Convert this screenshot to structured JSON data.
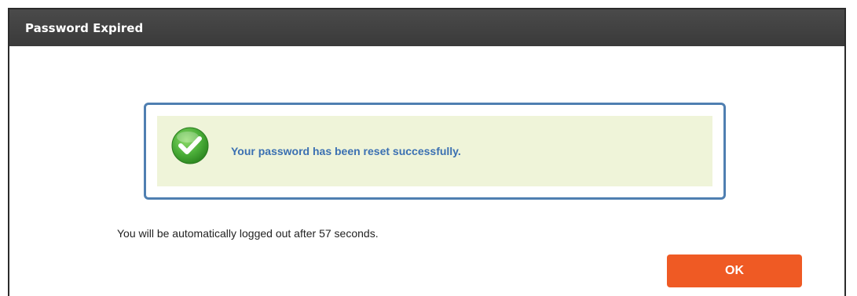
{
  "dialog": {
    "title": "Password Expired"
  },
  "message": {
    "icon": "checkmark-circle-icon",
    "text": "Your password has been reset successfully."
  },
  "logout_note": "You will be automatically logged out after 57 seconds.",
  "buttons": {
    "ok_label": "OK"
  },
  "colors": {
    "titlebar": "#3f3f3f",
    "message_border": "#4f7fb1",
    "message_background": "#eff4d9",
    "message_text": "#3b70b2",
    "ok_button": "#ef5a24",
    "success_icon": "#4caf3a"
  }
}
